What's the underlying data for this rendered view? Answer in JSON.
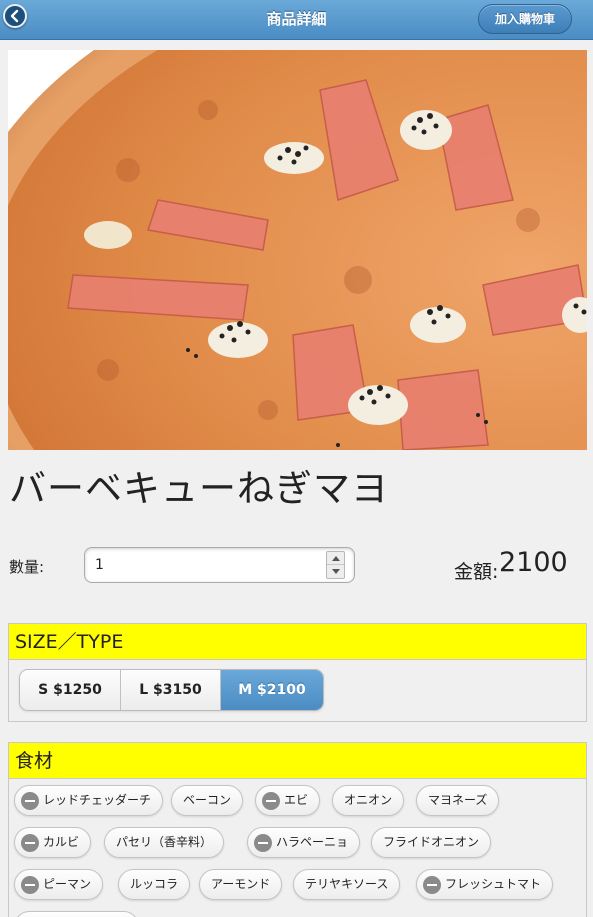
{
  "header": {
    "title": "商品詳細",
    "back_icon": "back-arrow-icon",
    "cart_button": "加入購物車"
  },
  "product": {
    "image": "pizza-photo",
    "name": "バーベキューねぎマヨ"
  },
  "quantity": {
    "label": "數量:",
    "value": "1"
  },
  "amount": {
    "label": "金額:",
    "value": "2100"
  },
  "size_section": {
    "heading": "SIZE／TYPE",
    "options": [
      {
        "label": "S $1250",
        "selected": false
      },
      {
        "label": "L $3150",
        "selected": false
      },
      {
        "label": "M $2100",
        "selected": true
      }
    ]
  },
  "ingredients_section": {
    "heading": "食材",
    "items": [
      {
        "label": "レッドチェッダーチ",
        "removable": true
      },
      {
        "label": "ベーコン",
        "removable": false
      },
      {
        "label": "エビ",
        "removable": true
      },
      {
        "label": "オニオン",
        "removable": false
      },
      {
        "label": "マヨネーズ",
        "removable": false
      },
      {
        "label": "カルビ",
        "removable": true
      },
      {
        "label": "パセリ（香辛料）",
        "removable": false
      },
      {
        "label": "ハラペーニョ",
        "removable": true
      },
      {
        "label": "フライドオニオン",
        "removable": false
      },
      {
        "label": "ピーマン",
        "removable": true
      },
      {
        "label": "ルッコラ",
        "removable": false
      },
      {
        "label": "アーモンド",
        "removable": false
      },
      {
        "label": "テリヤキソース",
        "removable": false
      },
      {
        "label": "フレッシュトマト",
        "removable": true
      }
    ]
  },
  "colors": {
    "header_blue": "#5a9ace",
    "section_yellow": "#ffff00",
    "selected_blue": "#5a9ace"
  }
}
